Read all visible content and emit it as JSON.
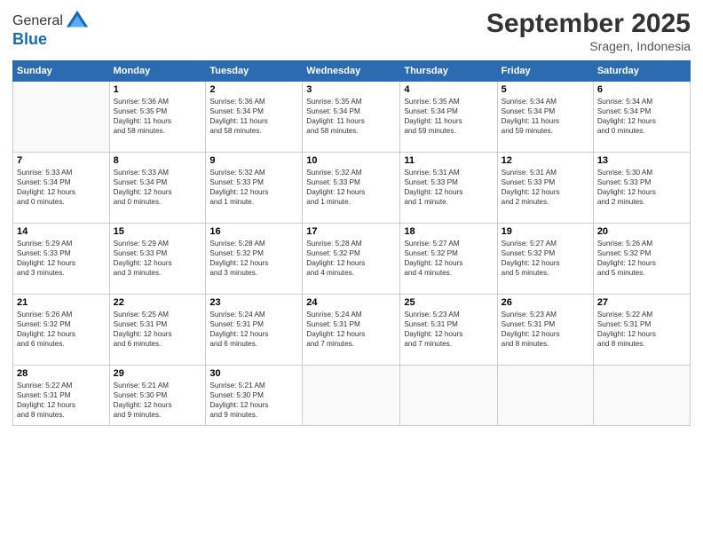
{
  "header": {
    "logo_line1": "General",
    "logo_line2": "Blue",
    "month": "September 2025",
    "location": "Sragen, Indonesia"
  },
  "weekdays": [
    "Sunday",
    "Monday",
    "Tuesday",
    "Wednesday",
    "Thursday",
    "Friday",
    "Saturday"
  ],
  "weeks": [
    [
      {
        "day": "",
        "info": ""
      },
      {
        "day": "1",
        "info": "Sunrise: 5:36 AM\nSunset: 5:35 PM\nDaylight: 11 hours\nand 58 minutes."
      },
      {
        "day": "2",
        "info": "Sunrise: 5:36 AM\nSunset: 5:34 PM\nDaylight: 11 hours\nand 58 minutes."
      },
      {
        "day": "3",
        "info": "Sunrise: 5:35 AM\nSunset: 5:34 PM\nDaylight: 11 hours\nand 58 minutes."
      },
      {
        "day": "4",
        "info": "Sunrise: 5:35 AM\nSunset: 5:34 PM\nDaylight: 11 hours\nand 59 minutes."
      },
      {
        "day": "5",
        "info": "Sunrise: 5:34 AM\nSunset: 5:34 PM\nDaylight: 11 hours\nand 59 minutes."
      },
      {
        "day": "6",
        "info": "Sunrise: 5:34 AM\nSunset: 5:34 PM\nDaylight: 12 hours\nand 0 minutes."
      }
    ],
    [
      {
        "day": "7",
        "info": "Sunrise: 5:33 AM\nSunset: 5:34 PM\nDaylight: 12 hours\nand 0 minutes."
      },
      {
        "day": "8",
        "info": "Sunrise: 5:33 AM\nSunset: 5:34 PM\nDaylight: 12 hours\nand 0 minutes."
      },
      {
        "day": "9",
        "info": "Sunrise: 5:32 AM\nSunset: 5:33 PM\nDaylight: 12 hours\nand 1 minute."
      },
      {
        "day": "10",
        "info": "Sunrise: 5:32 AM\nSunset: 5:33 PM\nDaylight: 12 hours\nand 1 minute."
      },
      {
        "day": "11",
        "info": "Sunrise: 5:31 AM\nSunset: 5:33 PM\nDaylight: 12 hours\nand 1 minute."
      },
      {
        "day": "12",
        "info": "Sunrise: 5:31 AM\nSunset: 5:33 PM\nDaylight: 12 hours\nand 2 minutes."
      },
      {
        "day": "13",
        "info": "Sunrise: 5:30 AM\nSunset: 5:33 PM\nDaylight: 12 hours\nand 2 minutes."
      }
    ],
    [
      {
        "day": "14",
        "info": "Sunrise: 5:29 AM\nSunset: 5:33 PM\nDaylight: 12 hours\nand 3 minutes."
      },
      {
        "day": "15",
        "info": "Sunrise: 5:29 AM\nSunset: 5:33 PM\nDaylight: 12 hours\nand 3 minutes."
      },
      {
        "day": "16",
        "info": "Sunrise: 5:28 AM\nSunset: 5:32 PM\nDaylight: 12 hours\nand 3 minutes."
      },
      {
        "day": "17",
        "info": "Sunrise: 5:28 AM\nSunset: 5:32 PM\nDaylight: 12 hours\nand 4 minutes."
      },
      {
        "day": "18",
        "info": "Sunrise: 5:27 AM\nSunset: 5:32 PM\nDaylight: 12 hours\nand 4 minutes."
      },
      {
        "day": "19",
        "info": "Sunrise: 5:27 AM\nSunset: 5:32 PM\nDaylight: 12 hours\nand 5 minutes."
      },
      {
        "day": "20",
        "info": "Sunrise: 5:26 AM\nSunset: 5:32 PM\nDaylight: 12 hours\nand 5 minutes."
      }
    ],
    [
      {
        "day": "21",
        "info": "Sunrise: 5:26 AM\nSunset: 5:32 PM\nDaylight: 12 hours\nand 6 minutes."
      },
      {
        "day": "22",
        "info": "Sunrise: 5:25 AM\nSunset: 5:31 PM\nDaylight: 12 hours\nand 6 minutes."
      },
      {
        "day": "23",
        "info": "Sunrise: 5:24 AM\nSunset: 5:31 PM\nDaylight: 12 hours\nand 6 minutes."
      },
      {
        "day": "24",
        "info": "Sunrise: 5:24 AM\nSunset: 5:31 PM\nDaylight: 12 hours\nand 7 minutes."
      },
      {
        "day": "25",
        "info": "Sunrise: 5:23 AM\nSunset: 5:31 PM\nDaylight: 12 hours\nand 7 minutes."
      },
      {
        "day": "26",
        "info": "Sunrise: 5:23 AM\nSunset: 5:31 PM\nDaylight: 12 hours\nand 8 minutes."
      },
      {
        "day": "27",
        "info": "Sunrise: 5:22 AM\nSunset: 5:31 PM\nDaylight: 12 hours\nand 8 minutes."
      }
    ],
    [
      {
        "day": "28",
        "info": "Sunrise: 5:22 AM\nSunset: 5:31 PM\nDaylight: 12 hours\nand 8 minutes."
      },
      {
        "day": "29",
        "info": "Sunrise: 5:21 AM\nSunset: 5:30 PM\nDaylight: 12 hours\nand 9 minutes."
      },
      {
        "day": "30",
        "info": "Sunrise: 5:21 AM\nSunset: 5:30 PM\nDaylight: 12 hours\nand 9 minutes."
      },
      {
        "day": "",
        "info": ""
      },
      {
        "day": "",
        "info": ""
      },
      {
        "day": "",
        "info": ""
      },
      {
        "day": "",
        "info": ""
      }
    ]
  ]
}
